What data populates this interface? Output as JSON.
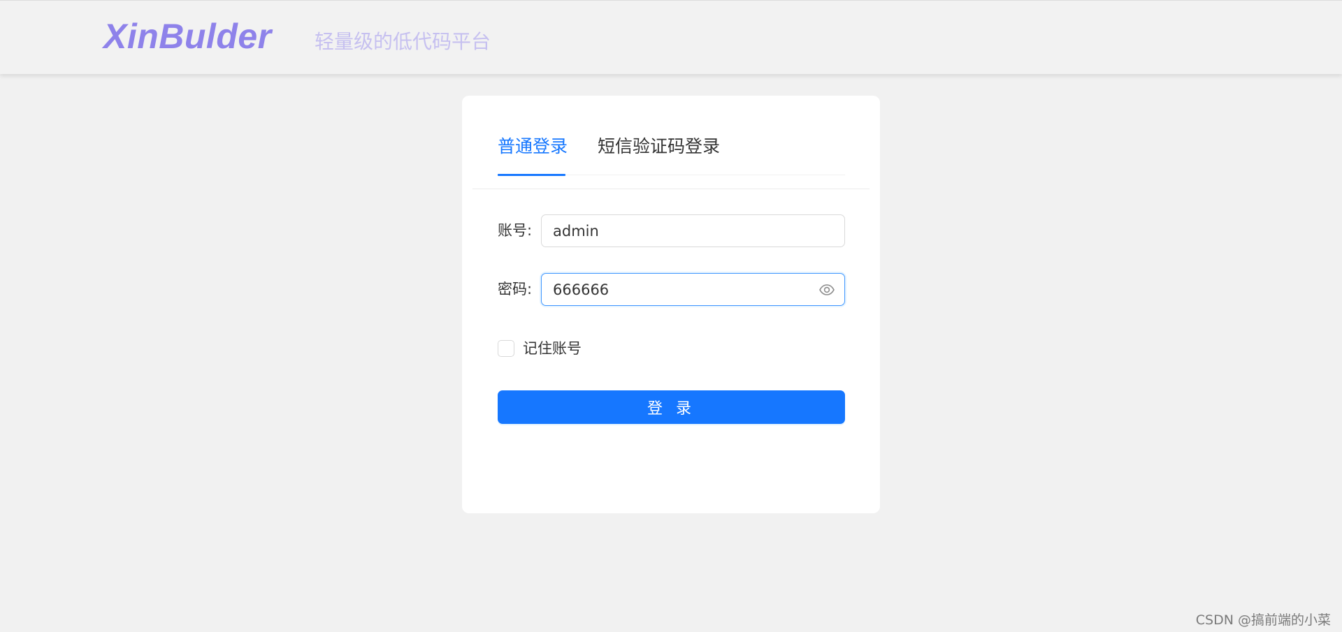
{
  "header": {
    "logo": "XinBulder",
    "slogan": "轻量级的低代码平台"
  },
  "login": {
    "tabs": [
      {
        "label": "普通登录",
        "active": true
      },
      {
        "label": "短信验证码登录",
        "active": false
      }
    ],
    "account_label": "账号:",
    "account_value": "admin",
    "password_label": "密码:",
    "password_value": "666666",
    "password_toggle_icon": "eye-icon",
    "remember_label": "记住账号",
    "remember_checked": false,
    "submit_label": "登 录"
  },
  "watermark": "CSDN @搞前端的小菜",
  "colors": {
    "primary": "#1677ff",
    "logo": "#8e82ea",
    "slogan": "#c6c0f0",
    "background": "#f1f1f1",
    "card": "#ffffff"
  }
}
